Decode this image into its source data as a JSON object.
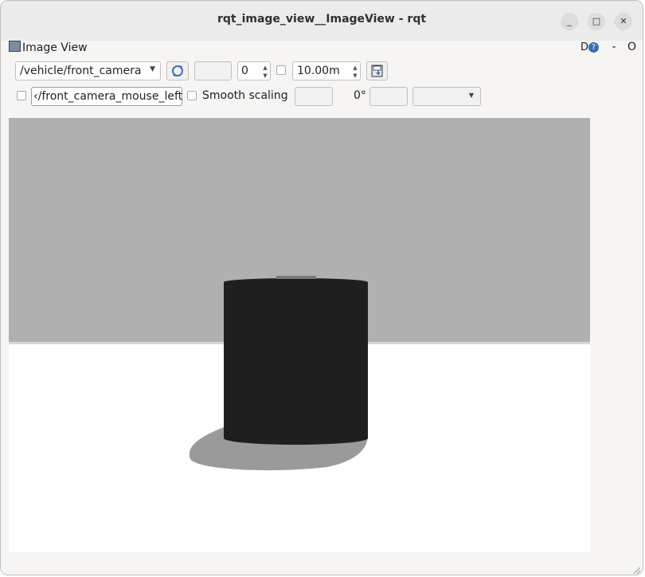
{
  "window": {
    "title": "rqt_image_view__ImageView - rqt",
    "minimize_glyph": "_",
    "maximize_glyph": "□",
    "close_glyph": "✕"
  },
  "dock": {
    "title": "Image View",
    "d_label": "D",
    "help_label": "?",
    "dash_label": "-",
    "o_label": "O"
  },
  "toolbar": {
    "topic_value": "/vehicle/front_camera",
    "spin_value": "0",
    "distance_value": "10.00m"
  },
  "toolbar2": {
    "mouse_topic_value": "‹/front_camera_mouse_left",
    "smooth_scaling_label": "Smooth scaling",
    "rotation_value": "0°"
  },
  "colors": {
    "sky": "#b0b0b0",
    "floor": "#ffffff",
    "cylinder": "#1f1f1f",
    "shadow": "#9a9a9a"
  }
}
